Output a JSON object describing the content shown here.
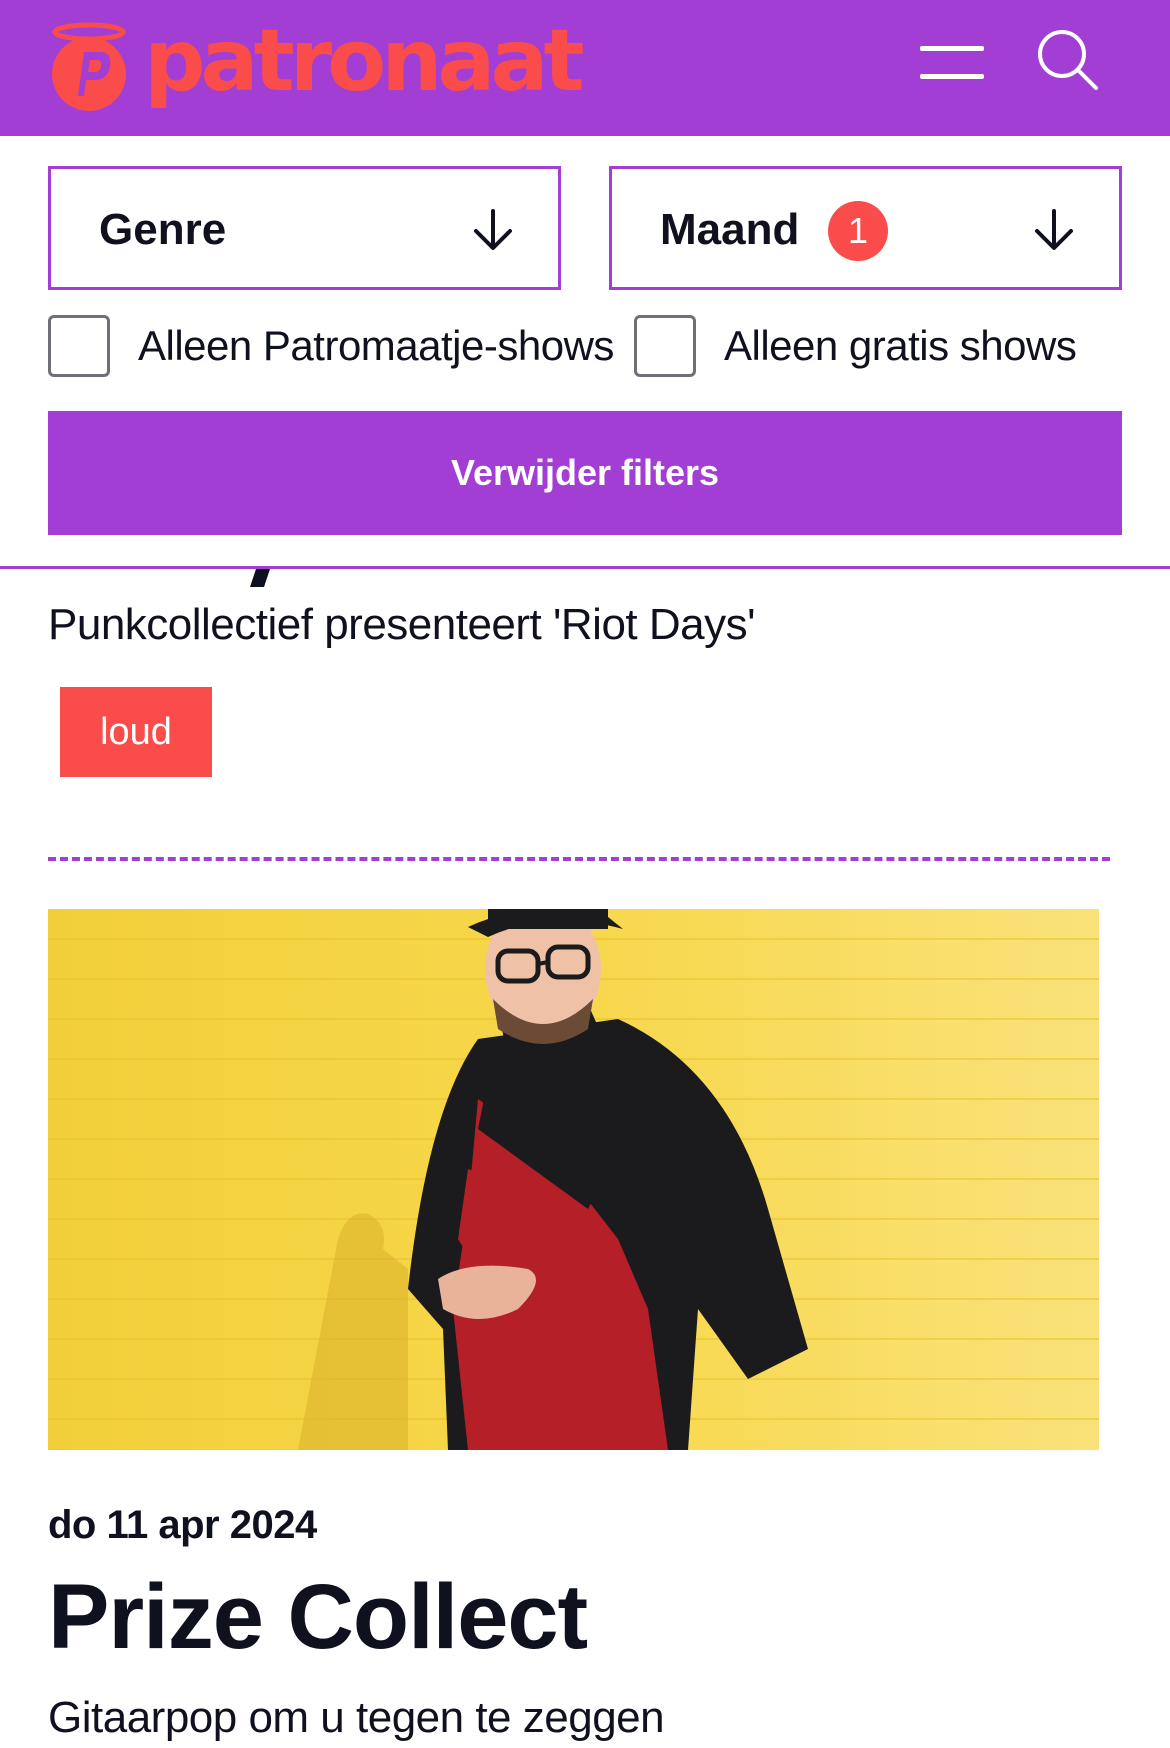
{
  "header": {
    "brand": "patronaat",
    "menu_icon": "hamburger-menu-icon",
    "search_icon": "search-icon",
    "colors": {
      "background": "#a23ed3",
      "brand": "#fa4c4a"
    }
  },
  "filters": {
    "genre": {
      "label": "Genre",
      "icon": "arrow-down-icon"
    },
    "maand": {
      "label": "Maand",
      "badge": "1",
      "icon": "arrow-down-icon"
    },
    "checkboxes": [
      {
        "label": "Alleen Patromaatje-shows",
        "checked": false
      },
      {
        "label": "Alleen gratis shows",
        "checked": false
      }
    ],
    "clear_button": "Verwijder filters"
  },
  "events": [
    {
      "subtitle": "Punkcollectief presenteert 'Riot Days'",
      "tag": "loud"
    },
    {
      "image": "artist-photo",
      "date": "do 11 apr 2024",
      "title": "Prize Collect",
      "subtitle": "Gitaarpop om u tegen te zeggen"
    }
  ]
}
